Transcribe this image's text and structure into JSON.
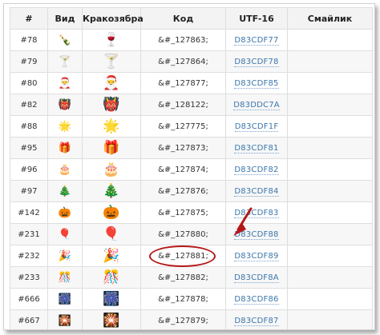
{
  "headers": [
    "#",
    "Вид",
    "Кракозябра",
    "Код",
    "UTF-16",
    "Смайлик"
  ],
  "rows": [
    {
      "num": "#78",
      "view": "🍾",
      "kra": "🍷",
      "code": "&#_127863;",
      "utf": "D83CDF77"
    },
    {
      "num": "#79",
      "view": "🍸",
      "kra": "🍸",
      "code": "&#_127864;",
      "utf": "D83CDF78"
    },
    {
      "num": "#80",
      "view": "🎅",
      "kra": "🎅",
      "code": "&#_127877;",
      "utf": "D83CDF85"
    },
    {
      "num": "#82",
      "view": "👹",
      "kra": "👹",
      "code": "&#_128122;",
      "utf": "D83DDC7A"
    },
    {
      "num": "#88",
      "view": "🌟",
      "kra": "🌟",
      "code": "&#_127775;",
      "utf": "D83CDF1F"
    },
    {
      "num": "#95",
      "view": "🎁",
      "kra": "🎁",
      "code": "&#_127873;",
      "utf": "D83CDF81"
    },
    {
      "num": "#96",
      "view": "🎂",
      "kra": "🎂",
      "code": "&#_127874;",
      "utf": "D83CDF82"
    },
    {
      "num": "#97",
      "view": "🎄",
      "kra": "🎄",
      "code": "&#_127876;",
      "utf": "D83CDF84"
    },
    {
      "num": "#142",
      "view": "🎃",
      "kra": "🎃",
      "code": "&#_127875;",
      "utf": "D83CDF83"
    },
    {
      "num": "#231",
      "view": "🎈",
      "kra": "🎈",
      "code": "&#_127880;",
      "utf": "D83CDF88"
    },
    {
      "num": "#232",
      "view": "🎉",
      "kra": "🎉",
      "code": "&#_127881;",
      "utf": "D83CDF89"
    },
    {
      "num": "#233",
      "view": "🎊",
      "kra": "🎊",
      "code": "&#_127882;",
      "utf": "D83CDF8A"
    },
    {
      "num": "#666",
      "view": "🎆",
      "kra": "🎆",
      "code": "&#_127878;",
      "utf": "D83CDF86"
    },
    {
      "num": "#667",
      "view": "🎇",
      "kra": "🎇",
      "code": "&#_127879;",
      "utf": "D83CDF87"
    }
  ],
  "highlight_row": 10,
  "accent_color": "#b51818",
  "link_color": "#3b76ab"
}
